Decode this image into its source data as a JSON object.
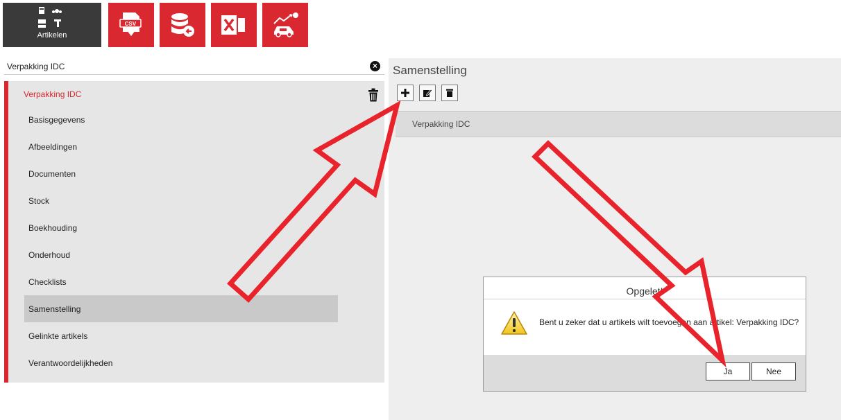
{
  "toolbar": {
    "articles_label": "Artikelen",
    "csv_label": "CSV",
    "brand_color": "#d9282f"
  },
  "search": {
    "value": "Verpakking IDC"
  },
  "left_panel": {
    "title": "Verpakking IDC",
    "menu": [
      "Basisgegevens",
      "Afbeeldingen",
      "Documenten",
      "Stock",
      "Boekhouding",
      "Onderhoud",
      "Checklists",
      "Samenstelling",
      "Gelinkte artikels",
      "Verantwoordelijkheden"
    ],
    "active_index": 7
  },
  "right_panel": {
    "title": "Samenstelling",
    "row_label": "Verpakking IDC"
  },
  "dialog": {
    "title": "Opgelet!",
    "message": "Bent u zeker dat u artikels wilt toevoegen aan artikel: Verpakking IDC?",
    "yes_label": "Ja",
    "no_label": "Nee"
  }
}
